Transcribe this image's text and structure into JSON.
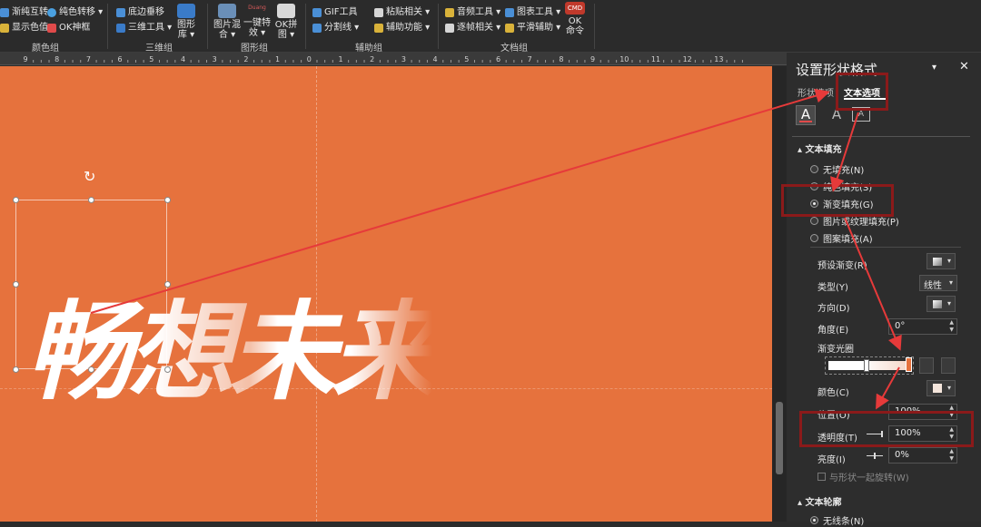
{
  "ribbon": {
    "buttons": [
      {
        "label": "渐纯互转 ▾",
        "color": "#4a8fd6"
      },
      {
        "label": "显示色值 ▾",
        "color": "#d9b23a"
      },
      {
        "label": "纯色转移 ▾",
        "color": "#4aa0e0"
      },
      {
        "label": "OK神框",
        "color": "#e04a4a"
      },
      {
        "label": "底边垂移",
        "color": "#4a8fd6"
      },
      {
        "label": "三维工具 ▾",
        "color": "#3a7bc8"
      },
      {
        "label": "GIF工具",
        "color": "#4a8fd6"
      },
      {
        "label": "分割线 ▾",
        "color": "#4a8fd6"
      },
      {
        "label": "粘贴相关 ▾",
        "color": "#d6d6d6"
      },
      {
        "label": "辅助功能 ▾",
        "color": "#d9b23a"
      },
      {
        "label": "音频工具 ▾",
        "color": "#d9b23a"
      },
      {
        "label": "逐帧相关 ▾",
        "color": "#d6d6d6"
      },
      {
        "label": "图表工具 ▾",
        "color": "#4a8fd6"
      },
      {
        "label": "平滑辅助 ▾",
        "color": "#d9b23a"
      }
    ],
    "big_buttons": [
      {
        "line1": "图形",
        "line2": "库 ▾",
        "color": "#3a7bc8"
      },
      {
        "line1": "图片混",
        "line2": "合 ▾",
        "color": "#6a8fb8"
      },
      {
        "line1": "一键特",
        "line2": "效 ▾",
        "color": "#d9d9d9"
      },
      {
        "line1": "OK拼",
        "line2": "图 ▾",
        "color": "#d9d9d9"
      },
      {
        "line1": "OK",
        "line2": "命令",
        "color": "#c0392b",
        "badge": "CMD"
      }
    ],
    "groups": [
      "颜色组",
      "三维组",
      "图形组",
      "辅助组",
      "文档组"
    ],
    "dimmed_label": "Duang"
  },
  "canvas": {
    "headline": "畅想未来",
    "background": "#e6723d",
    "rotate_handle": "↻"
  },
  "panel": {
    "title": "设置形状格式",
    "dropdown_glyph": "▾",
    "close_glyph": "✕",
    "tabs": [
      {
        "label": "形状选项",
        "active": false
      },
      {
        "label": "文本选项",
        "active": true
      }
    ],
    "fill_section": "文本填充",
    "fill_options": [
      {
        "label": "无填充(N)",
        "checked": false
      },
      {
        "label": "纯色填充(S)",
        "checked": false
      },
      {
        "label": "渐变填充(G)",
        "checked": true
      },
      {
        "label": "图片或纹理填充(P)",
        "checked": false
      },
      {
        "label": "图案填充(A)",
        "checked": false
      }
    ],
    "preset_label": "预设渐变(R)",
    "type_label": "类型(Y)",
    "type_value": "线性",
    "direction_label": "方向(D)",
    "angle_label": "角度(E)",
    "angle_value": "0°",
    "stops_label": "渐变光圈",
    "color_label": "颜色(C)",
    "position_label": "位置(O)",
    "position_value": "100%",
    "transparency_label": "透明度(T)",
    "transparency_value": "100%",
    "brightness_label": "亮度(I)",
    "brightness_value": "0%",
    "rotate_with_shape": "与形状一起旋转(W)",
    "outline_section": "文本轮廓",
    "outline_first": "无线条(N)"
  },
  "ruler": {
    "ticks": [
      "9",
      "8",
      "7",
      "6",
      "5",
      "4",
      "3",
      "2",
      "1",
      "0",
      "1",
      "2",
      "3",
      "4",
      "5",
      "6",
      "7",
      "8",
      "9",
      "10",
      "11",
      "12",
      "13"
    ]
  },
  "colors": {
    "annotation_red": "#e63a3a",
    "box_red": "#8b1a1a",
    "accent_orange": "#e6723d"
  }
}
